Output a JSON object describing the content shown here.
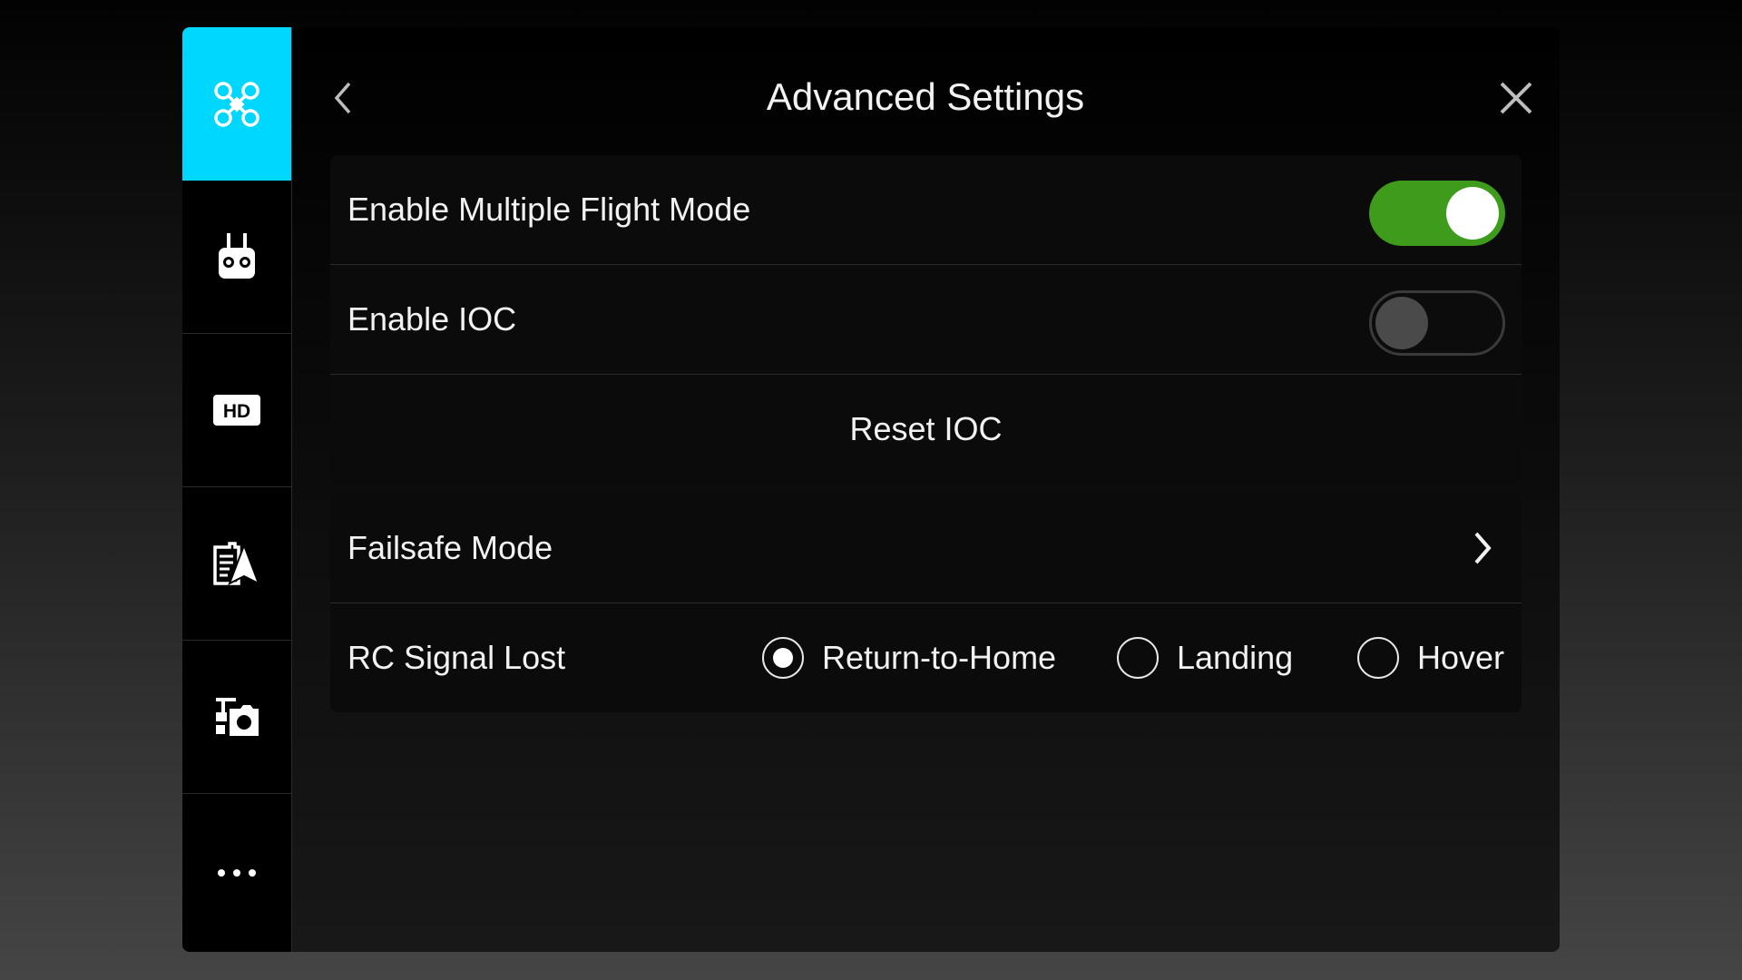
{
  "header": {
    "title": "Advanced Settings"
  },
  "sidebar": {
    "items": [
      {
        "name": "aircraft",
        "icon": "aircraft-icon",
        "active": true
      },
      {
        "name": "remote-controller",
        "icon": "remote-controller-icon",
        "active": false
      },
      {
        "name": "hd-transmission",
        "icon": "hd-icon",
        "active": false
      },
      {
        "name": "battery",
        "icon": "battery-icon",
        "active": false
      },
      {
        "name": "gimbal-camera",
        "icon": "gimbal-icon",
        "active": false
      },
      {
        "name": "more",
        "icon": "more-icon",
        "active": false
      }
    ]
  },
  "settings": {
    "multiple_flight_mode": {
      "label": "Enable Multiple Flight Mode",
      "enabled": true
    },
    "ioc": {
      "label": "Enable IOC",
      "enabled": false
    },
    "reset_ioc": {
      "label": "Reset IOC"
    },
    "failsafe": {
      "label": "Failsafe Mode"
    },
    "rc_signal_lost": {
      "label": "RC Signal Lost",
      "options": [
        "Return-to-Home",
        "Landing",
        "Hover"
      ],
      "selected": "Return-to-Home"
    }
  },
  "colors": {
    "accent": "#00d7ff",
    "toggle_on": "#3e9b1b",
    "background": "#000000"
  }
}
